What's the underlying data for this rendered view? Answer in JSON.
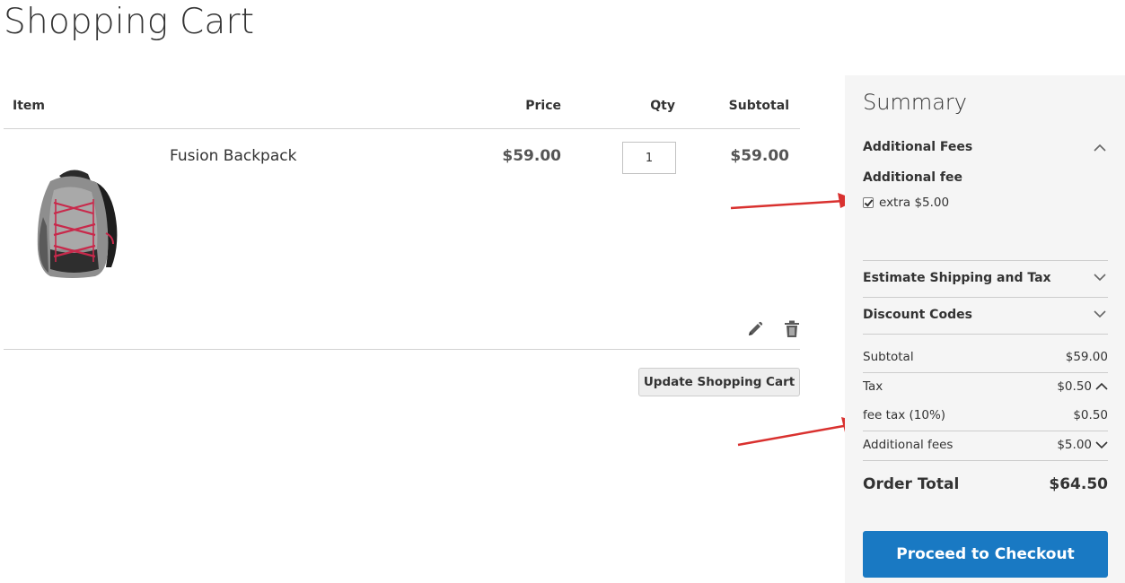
{
  "page": {
    "title": "Shopping Cart"
  },
  "cart": {
    "headers": {
      "item": "Item",
      "price": "Price",
      "qty": "Qty",
      "subtotal": "Subtotal"
    },
    "items": [
      {
        "name": "Fusion Backpack",
        "price": "$59.00",
        "qty": "1",
        "subtotal": "$59.00"
      }
    ],
    "update_label": "Update Shopping Cart"
  },
  "summary": {
    "title": "Summary",
    "additional_fees_section": "Additional Fees",
    "fee_group_label": "Additional fee",
    "fee_option": "extra $5.00",
    "fee_option_checked": true,
    "shipping_section": "Estimate Shipping and Tax",
    "discount_section": "Discount Codes",
    "totals": {
      "subtotal_label": "Subtotal",
      "subtotal_value": "$59.00",
      "tax_label": "Tax",
      "tax_value": "$0.50",
      "fee_tax_label": "fee tax (10%)",
      "fee_tax_value": "$0.50",
      "additional_fees_label": "Additional fees",
      "additional_fees_value": "$5.00",
      "order_total_label": "Order Total",
      "order_total_value": "$64.50"
    },
    "checkout_label": "Proceed to Checkout"
  },
  "colors": {
    "accent": "#1979c3",
    "annotation_arrow": "#d9312f",
    "summary_bg": "#f5f5f5"
  }
}
